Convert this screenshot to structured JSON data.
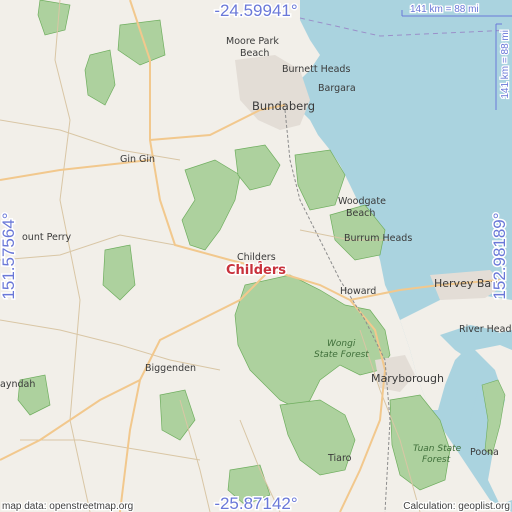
{
  "map": {
    "place_name": "Childers",
    "place_label": "Childers",
    "coords": {
      "lat_top": "-24.59941°",
      "lat_bottom": "-25.87142°",
      "lon_left": "151.57564°",
      "lon_right": "152.98189°"
    },
    "scale_horizontal": "141 km = 88 mi",
    "scale_vertical": "141 km = 88 mi",
    "attribution": "map data: openstreetmap.org",
    "calculation": "Calculation: geoplist.org",
    "towns": {
      "moore_park": "Moore Park",
      "moore_park_2": "Beach",
      "burnett_heads": "Burnett Heads",
      "bargara": "Bargara",
      "bundaberg": "Bundaberg",
      "gin_gin": "Gin Gin",
      "woodgate": "Woodgate",
      "woodgate_2": "Beach",
      "burrum_heads": "Burrum Heads",
      "mount_perry": "ount Perry",
      "childers_small": "Childers",
      "howard": "Howard",
      "hervey_bay": "Hervey Bay",
      "river_heads": "River Heads",
      "wongi_1": "Wongi",
      "wongi_2": "State Forest",
      "maryborough": "Maryborough",
      "biggenden": "Biggenden",
      "gayndah": "ayndah",
      "tuan_1": "Tuan State",
      "tuan_2": "Forest",
      "tiaro": "Tiaro",
      "poona": "Poona"
    },
    "colors": {
      "land": "#f2efe9",
      "sea": "#aad3df",
      "forest": "#add19e",
      "forest_edge": "#6fae5f",
      "road_major": "#f2c88d",
      "road_minor": "#d9c6a5",
      "rail": "#8c8c8c",
      "accent": "#6a78d8",
      "marker": "#c8323c"
    },
    "icons": [
      "place-marker-dot"
    ]
  }
}
